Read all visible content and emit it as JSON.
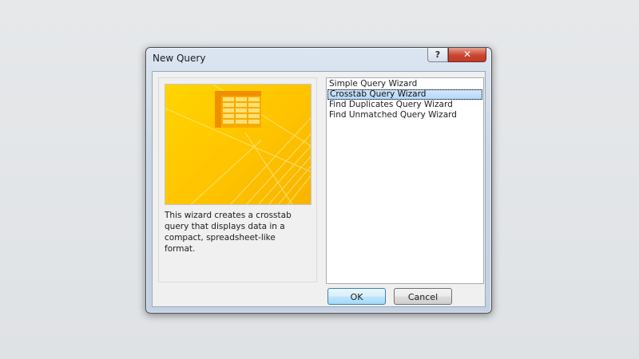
{
  "dialog": {
    "title": "New Query",
    "help_label": "?",
    "close_label": "✕"
  },
  "preview": {
    "description": "This wizard creates a crosstab query that displays data in a compact, spreadsheet-like format.",
    "colors": {
      "background": "#ffcc00",
      "table_header": "#f39a00",
      "table_cells": "#ffe680"
    }
  },
  "wizards": {
    "items": [
      {
        "label": "Simple Query Wizard",
        "selected": false
      },
      {
        "label": "Crosstab Query Wizard",
        "selected": true
      },
      {
        "label": "Find Duplicates Query Wizard",
        "selected": false
      },
      {
        "label": "Find Unmatched Query Wizard",
        "selected": false
      }
    ]
  },
  "buttons": {
    "ok_label": "OK",
    "cancel_label": "Cancel"
  }
}
